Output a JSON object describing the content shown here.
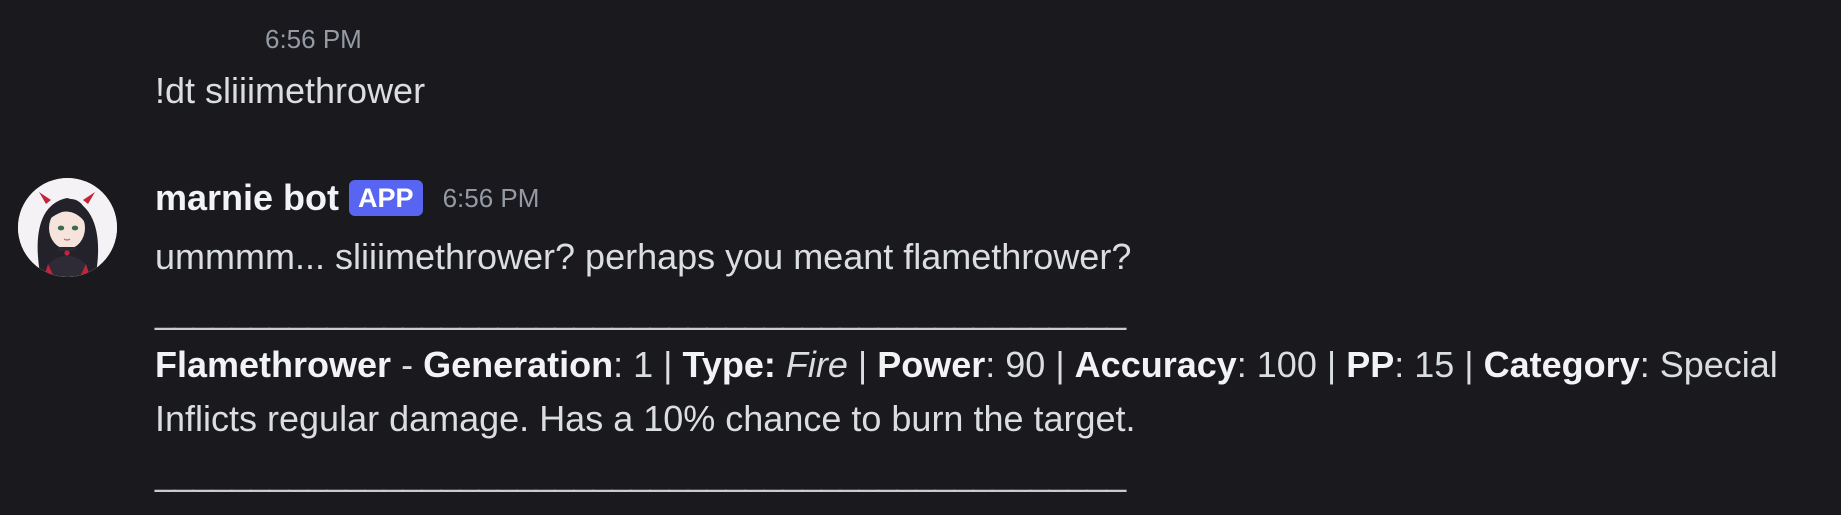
{
  "messages": {
    "followup": {
      "time": "6:56 PM",
      "text": "!dt sliiimethrower"
    },
    "bot": {
      "username": "marnie bot",
      "badge": "APP",
      "time": "6:56 PM",
      "line1": "ummmm... sliiimethrower? perhaps you meant flamethrower?",
      "divider": "___________________________________________________",
      "move": {
        "name": "Flamethrower",
        "dash": " - ",
        "generation_label": "Generation",
        "generation_value": ": 1 | ",
        "type_label": "Type:",
        "type_value": "Fire",
        "sep1": " | ",
        "power_label": "Power",
        "power_value": ": 90 | ",
        "accuracy_label": "Accuracy",
        "accuracy_value": ": 100 | ",
        "pp_label": "PP",
        "pp_value": ": 15 | ",
        "category_label": "Category",
        "category_value": ": Special"
      },
      "description": "Inflicts regular damage.  Has a 10% chance to burn the target.",
      "divider2": "___________________________________________________"
    }
  },
  "colors": {
    "background": "#1a1a1e",
    "badge": "#5865f2",
    "muted": "#949ba4",
    "text": "#dbdee1"
  }
}
